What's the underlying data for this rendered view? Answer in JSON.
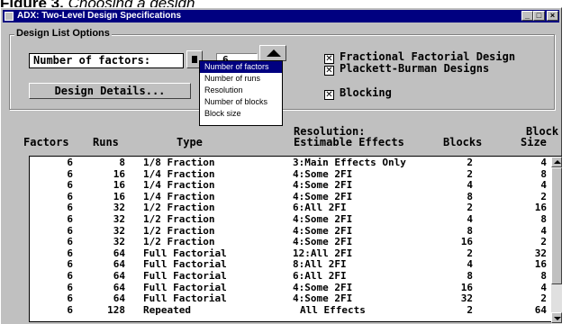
{
  "caption": {
    "prefix": "Figure 3.",
    "suffix": "Choosing a design"
  },
  "window": {
    "title": "ADX: Two-Level Design Specifications",
    "controls": {
      "minimize": "_",
      "maximize": "□",
      "close": "×"
    }
  },
  "design_list_options": {
    "group_label": "Design List Options",
    "factors_field": {
      "value": "Number of factors:"
    },
    "spin_value": "6",
    "design_details_button": "Design Details...",
    "checkboxes": [
      {
        "label": "Fractional Factorial Design",
        "checked": true
      },
      {
        "label": "Plackett-Burman Designs",
        "checked": true
      },
      {
        "label": "Blocking",
        "checked": true
      }
    ],
    "sort_menu": {
      "items": [
        "Number of factors",
        "Number of runs",
        "Resolution",
        "Number of blocks",
        "Block size"
      ],
      "selected": "Number of factors"
    }
  },
  "table": {
    "headers": {
      "factors": "Factors",
      "runs": "Runs",
      "type": "Type",
      "resolution_line1": "Resolution:",
      "resolution_line2": "Estimable Effects",
      "blocks": "Blocks",
      "block_line1": "Block",
      "block_line2": "Size"
    },
    "rows": [
      {
        "factors": "6",
        "runs": "8",
        "type": "1/8 Fraction",
        "res": "3:Main Effects Only",
        "blocks": "2",
        "bsize": "4"
      },
      {
        "factors": "6",
        "runs": "16",
        "type": "1/4 Fraction",
        "res": "4:Some 2FI",
        "blocks": "2",
        "bsize": "8"
      },
      {
        "factors": "6",
        "runs": "16",
        "type": "1/4 Fraction",
        "res": "4:Some 2FI",
        "blocks": "4",
        "bsize": "4"
      },
      {
        "factors": "6",
        "runs": "16",
        "type": "1/4 Fraction",
        "res": "4:Some 2FI",
        "blocks": "8",
        "bsize": "2"
      },
      {
        "factors": "6",
        "runs": "32",
        "type": "1/2 Fraction",
        "res": "6:All 2FI",
        "blocks": "2",
        "bsize": "16"
      },
      {
        "factors": "6",
        "runs": "32",
        "type": "1/2 Fraction",
        "res": "4:Some 2FI",
        "blocks": "4",
        "bsize": "8"
      },
      {
        "factors": "6",
        "runs": "32",
        "type": "1/2 Fraction",
        "res": "4:Some 2FI",
        "blocks": "8",
        "bsize": "4"
      },
      {
        "factors": "6",
        "runs": "32",
        "type": "1/2 Fraction",
        "res": "4:Some 2FI",
        "blocks": "16",
        "bsize": "2"
      },
      {
        "factors": "6",
        "runs": "64",
        "type": "Full Factorial",
        "res": "12:All 2FI",
        "blocks": "2",
        "bsize": "32"
      },
      {
        "factors": "6",
        "runs": "64",
        "type": "Full Factorial",
        "res": "8:All 2FI",
        "blocks": "4",
        "bsize": "16"
      },
      {
        "factors": "6",
        "runs": "64",
        "type": "Full Factorial",
        "res": "6:All 2FI",
        "blocks": "8",
        "bsize": "8"
      },
      {
        "factors": "6",
        "runs": "64",
        "type": "Full Factorial",
        "res": "4:Some 2FI",
        "blocks": "16",
        "bsize": "4"
      },
      {
        "factors": "6",
        "runs": "64",
        "type": "Full Factorial",
        "res": "4:Some 2FI",
        "blocks": "32",
        "bsize": "2"
      },
      {
        "factors": "6",
        "runs": "128",
        "type": "Repeated",
        "res": "All Effects",
        "blocks": "2",
        "bsize": "64"
      }
    ]
  },
  "colors": {
    "window_bg": "#c0c0c0",
    "titlebar": "#000080",
    "selection": "#000080"
  }
}
